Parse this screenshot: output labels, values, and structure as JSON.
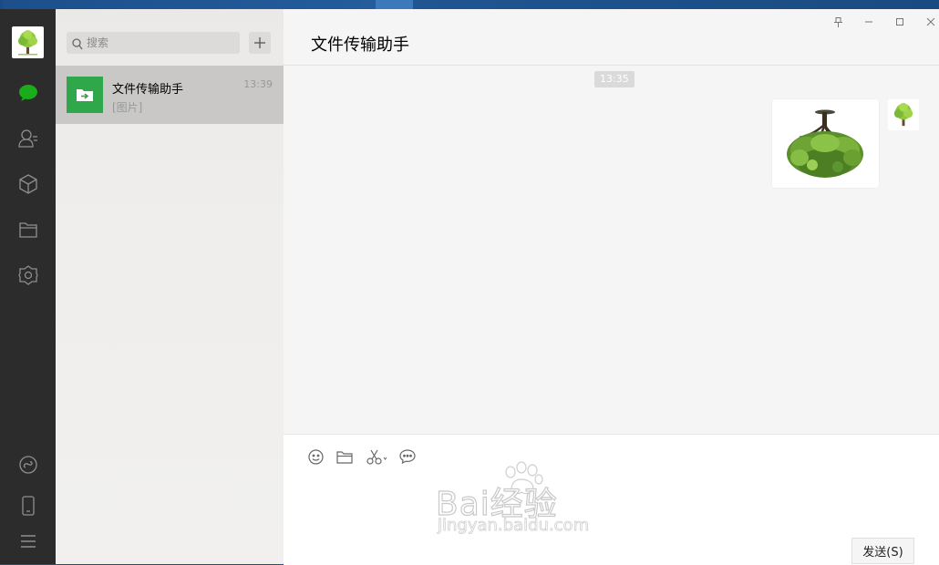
{
  "app": {
    "search_placeholder": "搜索"
  },
  "conversation_list": [
    {
      "name": "文件传输助手",
      "preview": "[图片]",
      "time": "13:39"
    }
  ],
  "chat": {
    "title": "文件传输助手",
    "timestamp": "13:35",
    "message_type": "image"
  },
  "input": {
    "send_label": "发送(S)",
    "tools": [
      "emoji-icon",
      "folder-icon",
      "scissors-icon",
      "chat-bubble-icon"
    ]
  },
  "nav_icons": [
    "chat-icon",
    "contacts-icon",
    "box-icon",
    "folder-icon",
    "settings-hex-icon",
    "mini-program-icon",
    "phone-icon",
    "menu-icon"
  ],
  "colors": {
    "nav_bg": "#2c2c2c",
    "active_chat_icon": "#1aad19",
    "file_helper_green": "#2ea84a",
    "selected_item": "#c9c8c7"
  },
  "watermark": {
    "line1": "Bai经验",
    "line2": "jingyan.baidu.com"
  }
}
